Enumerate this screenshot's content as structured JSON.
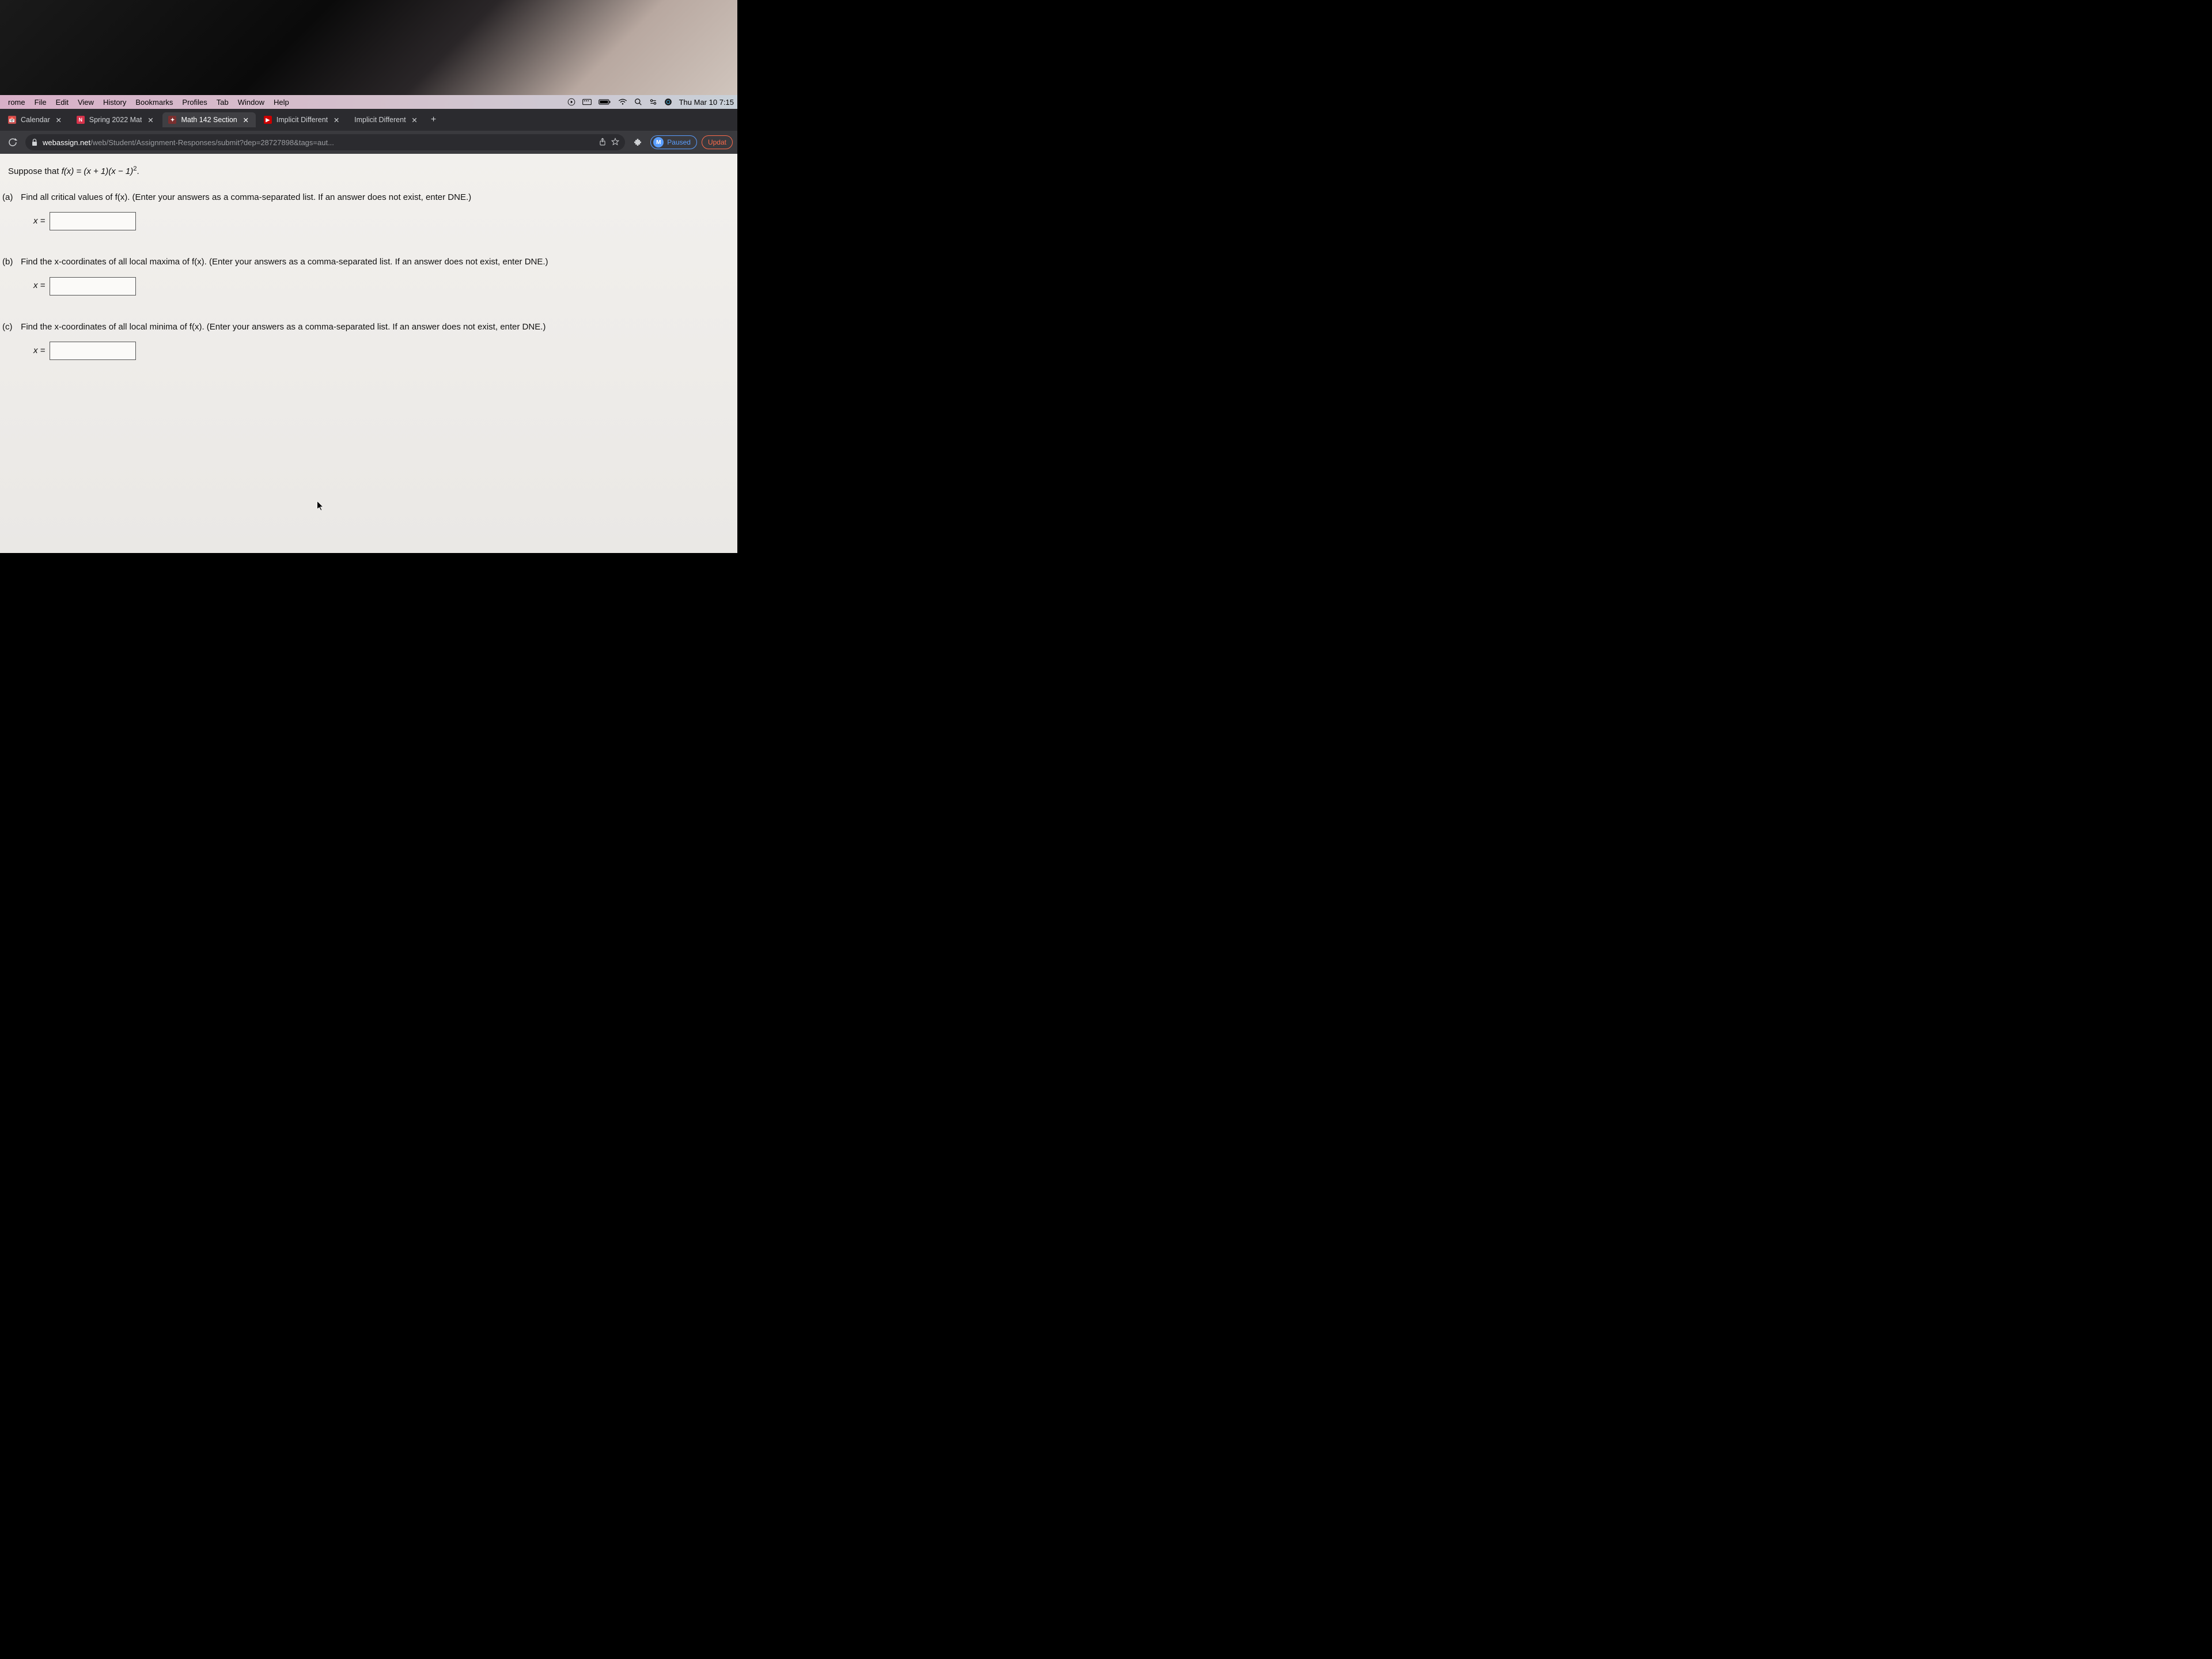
{
  "menubar": {
    "app_truncated": "rome",
    "items": [
      "File",
      "Edit",
      "View",
      "History",
      "Bookmarks",
      "Profiles",
      "Tab",
      "Window",
      "Help"
    ],
    "clock": "Thu Mar 10 7:15"
  },
  "tabs": [
    {
      "title": "Calendar",
      "favicon_letter": "",
      "favicon_bg": "#c94f4f",
      "active": false
    },
    {
      "title": "Spring 2022 Mat",
      "favicon_letter": "N",
      "favicon_bg": "#d6324a",
      "active": false
    },
    {
      "title": "Math 142 Section",
      "favicon_letter": "",
      "favicon_bg": "#7a2f2f",
      "active": true
    },
    {
      "title": "Implicit Different",
      "favicon_letter": "▶",
      "favicon_bg": "#cc0000",
      "active": false
    },
    {
      "title": "Implicit Different",
      "favicon_letter": "",
      "favicon_bg": "",
      "active": false
    }
  ],
  "new_tab_glyph": "+",
  "address": {
    "host": "webassign.net",
    "path": "/web/Student/Assignment-Responses/submit?dep=28727898&tags=aut..."
  },
  "profile": {
    "initial": "M",
    "status": "Paused"
  },
  "update_label": "Updat",
  "question": {
    "intro_prefix": "Suppose that ",
    "intro_func": "f(x) = (x + 1)(x − 1)",
    "intro_exp": "2",
    "intro_suffix": ".",
    "parts": [
      {
        "label": "(a)",
        "text": "Find all critical values of f(x). (Enter your answers as a comma-separated list. If an answer does not exist, enter DNE.)",
        "answer_label": "x ="
      },
      {
        "label": "(b)",
        "text": "Find the x-coordinates of all local maxima of f(x). (Enter your answers as a comma-separated list. If an answer does not exist, enter DNE.)",
        "answer_label": "x ="
      },
      {
        "label": "(c)",
        "text": "Find the x-coordinates of all local minima of f(x). (Enter your answers as a comma-separated list. If an answer does not exist, enter DNE.)",
        "answer_label": "x ="
      }
    ]
  }
}
